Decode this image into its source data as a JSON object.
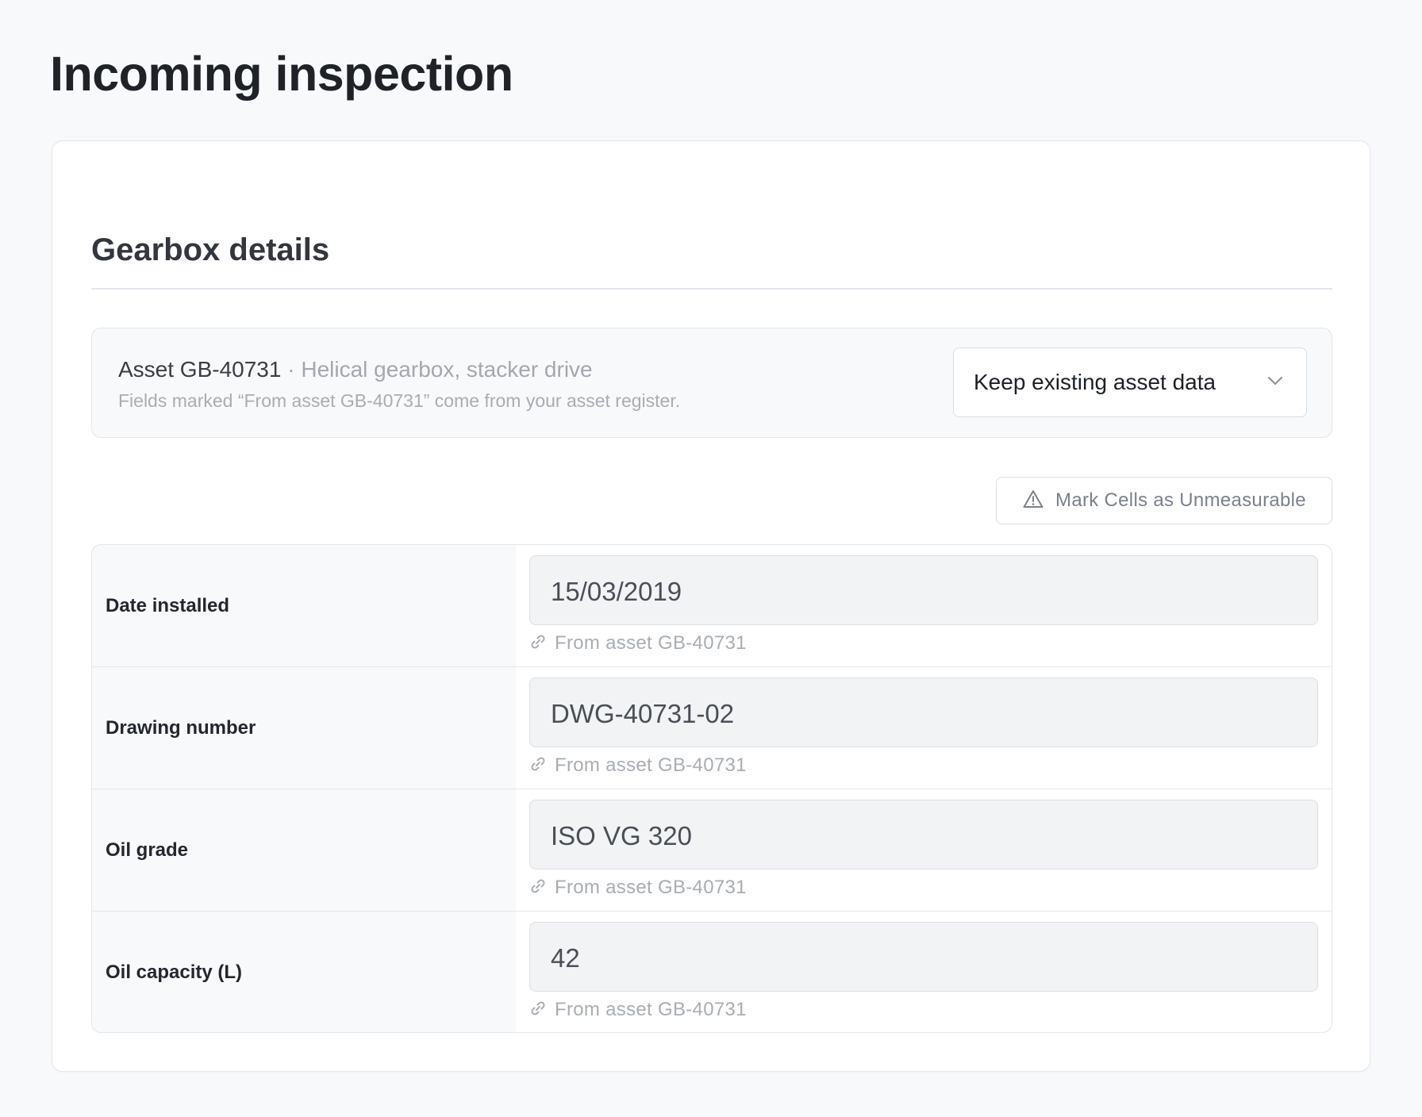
{
  "page": {
    "title": "Incoming inspection"
  },
  "section": {
    "title": "Gearbox details"
  },
  "asset": {
    "id_label": "Asset GB-40731",
    "separator": " · ",
    "description": "Helical gearbox, stacker drive",
    "note": "Fields marked “From asset GB-40731” come from your asset register.",
    "mode_select": {
      "value": "Keep existing asset data",
      "icon": "chevron-down-icon"
    }
  },
  "toolbar": {
    "mark_unmeasurable_label": "Mark Cells as Unmeasurable",
    "icon": "warning-triangle-icon"
  },
  "rows": [
    {
      "label": "Date installed",
      "value": "15/03/2019",
      "source": "From asset GB-40731"
    },
    {
      "label": "Drawing number",
      "value": "DWG-40731-02",
      "source": "From asset GB-40731"
    },
    {
      "label": "Oil grade",
      "value": "ISO VG 320",
      "source": "From asset GB-40731"
    },
    {
      "label": "Oil capacity (L)",
      "value": "42",
      "source": "From asset GB-40731"
    }
  ],
  "source_icon": "link-icon"
}
